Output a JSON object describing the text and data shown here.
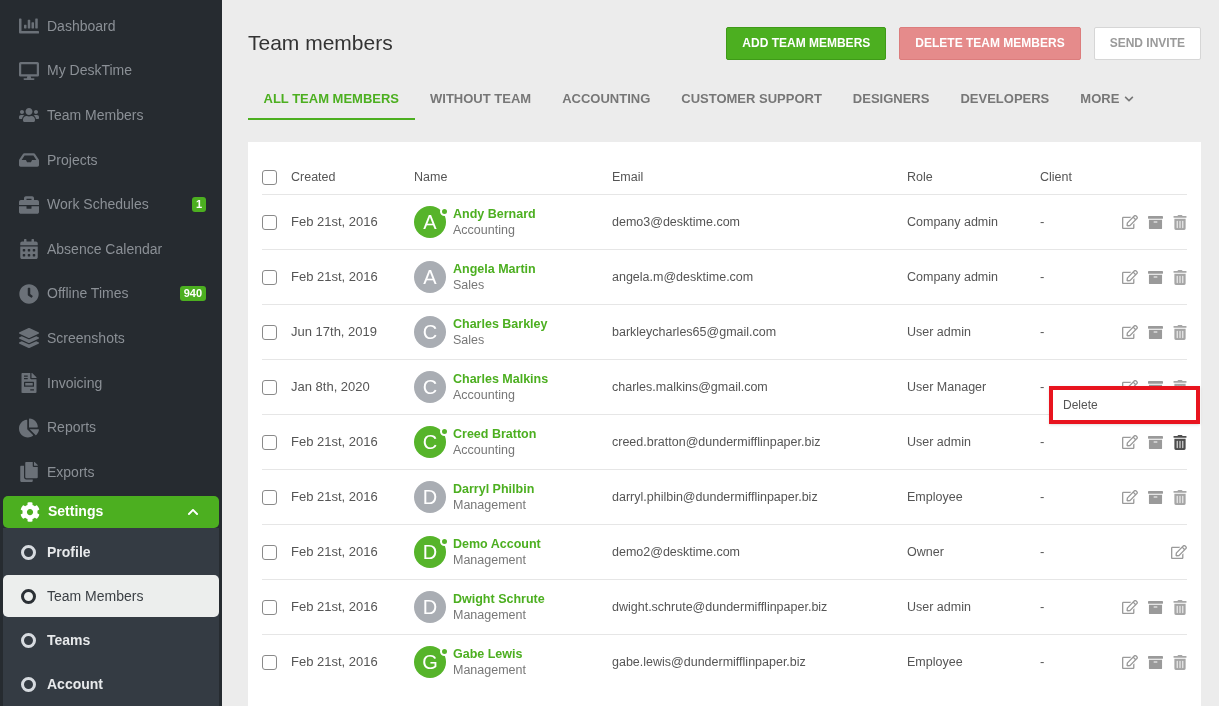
{
  "sidebar": {
    "items": [
      {
        "label": "Dashboard"
      },
      {
        "label": "My DeskTime"
      },
      {
        "label": "Team Members"
      },
      {
        "label": "Projects"
      },
      {
        "label": "Work Schedules",
        "badge": "1"
      },
      {
        "label": "Absence Calendar"
      },
      {
        "label": "Offline Times",
        "badge": "940"
      },
      {
        "label": "Screenshots"
      },
      {
        "label": "Invoicing"
      },
      {
        "label": "Reports"
      },
      {
        "label": "Exports"
      }
    ],
    "settings": {
      "label": "Settings",
      "expanded": true,
      "children": [
        {
          "label": "Profile",
          "selected": false
        },
        {
          "label": "Team Members",
          "selected": true
        },
        {
          "label": "Teams",
          "selected": false
        },
        {
          "label": "Account",
          "selected": false
        }
      ]
    }
  },
  "page": {
    "title": "Team members",
    "buttons": [
      {
        "label": "ADD TEAM MEMBERS",
        "kind": "primary"
      },
      {
        "label": "DELETE TEAM MEMBERS",
        "kind": "danger"
      },
      {
        "label": "SEND INVITE",
        "kind": "plain"
      }
    ]
  },
  "tabs": [
    {
      "label": "ALL TEAM MEMBERS",
      "selected": true
    },
    {
      "label": "WITHOUT TEAM",
      "selected": false
    },
    {
      "label": "ACCOUNTING",
      "selected": false
    },
    {
      "label": "CUSTOMER SUPPORT",
      "selected": false
    },
    {
      "label": "DESIGNERS",
      "selected": false
    },
    {
      "label": "DEVELOPERS",
      "selected": false
    },
    {
      "label": "MORE",
      "selected": false
    }
  ],
  "table": {
    "all_checked": false,
    "columns": [
      "Created",
      "Name",
      "Email",
      "Role",
      "Client"
    ],
    "rows": [
      {
        "checked": false,
        "created": "Feb 21st, 2016",
        "initial": "A",
        "online": true,
        "name": "Andy Bernard",
        "team": "Accounting",
        "email": "demo3@desktime.com",
        "role": "Company admin",
        "client": "-",
        "kind": "full",
        "hovered": false
      },
      {
        "checked": false,
        "created": "Feb 21st, 2016",
        "initial": "A",
        "online": false,
        "name": "Angela Martin",
        "team": "Sales",
        "email": "angela.m@desktime.com",
        "role": "Company admin",
        "client": "-",
        "kind": "full",
        "hovered": false
      },
      {
        "checked": false,
        "created": "Jun 17th, 2019",
        "initial": "C",
        "online": false,
        "name": "Charles Barkley",
        "team": "Sales",
        "email": "barkleycharles65@gmail.com",
        "role": "User admin",
        "client": "-",
        "kind": "full",
        "hovered": false
      },
      {
        "checked": false,
        "created": "Jan 8th, 2020",
        "initial": "C",
        "online": false,
        "name": "Charles Malkins",
        "team": "Accounting",
        "email": "charles.malkins@gmail.com",
        "role": "User Manager",
        "client": "-",
        "kind": "full",
        "hovered": false
      },
      {
        "checked": false,
        "created": "Feb 21st, 2016",
        "initial": "C",
        "online": true,
        "name": "Creed Bratton",
        "team": "Accounting",
        "email": "creed.bratton@dundermifflinpaper.biz",
        "role": "User admin",
        "client": "-",
        "kind": "full",
        "hovered": true
      },
      {
        "checked": false,
        "created": "Feb 21st, 2016",
        "initial": "D",
        "online": false,
        "name": "Darryl Philbin",
        "team": "Management",
        "email": "darryl.philbin@dundermifflinpaper.biz",
        "role": "Employee",
        "client": "-",
        "kind": "full",
        "hovered": false
      },
      {
        "checked": false,
        "created": "Feb 21st, 2016",
        "initial": "D",
        "online": true,
        "name": "Demo Account",
        "team": "Management",
        "email": "demo2@desktime.com",
        "role": "Owner",
        "client": "-",
        "kind": "edit",
        "hovered": false
      },
      {
        "checked": false,
        "created": "Feb 21st, 2016",
        "initial": "D",
        "online": false,
        "name": "Dwight Schrute",
        "team": "Management",
        "email": "dwight.schrute@dundermifflinpaper.biz",
        "role": "User admin",
        "client": "-",
        "kind": "full",
        "hovered": false
      },
      {
        "checked": false,
        "created": "Feb 21st, 2016",
        "initial": "G",
        "online": true,
        "name": "Gabe Lewis",
        "team": "Management",
        "email": "gabe.lewis@dundermifflinpaper.biz",
        "role": "Employee",
        "client": "-",
        "kind": "full",
        "hovered": false
      }
    ]
  },
  "tooltip": {
    "label": "Delete",
    "highlighted": true
  }
}
